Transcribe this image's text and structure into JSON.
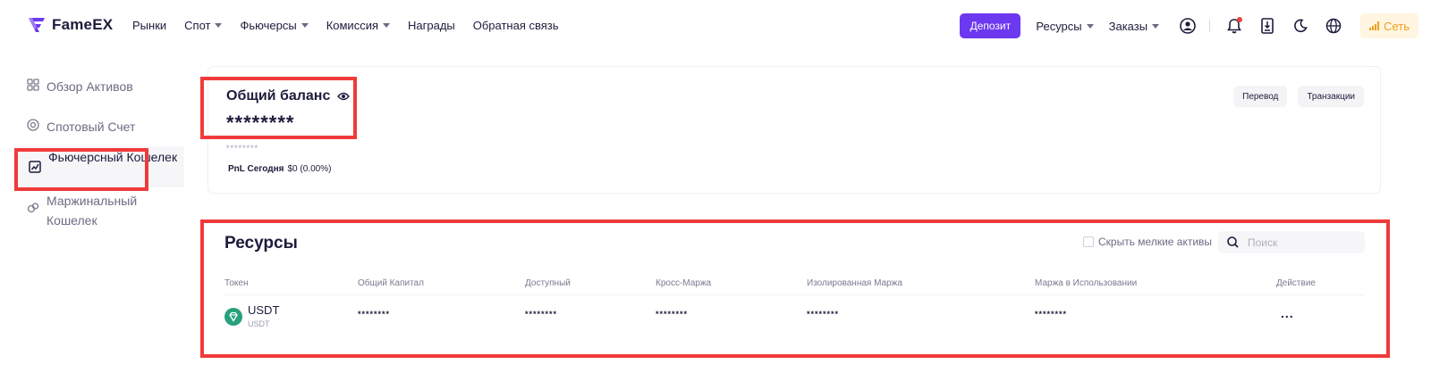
{
  "header": {
    "logo_text": "FameEX",
    "nav": [
      {
        "label": "Рынки",
        "dropdown": false
      },
      {
        "label": "Спот",
        "dropdown": true
      },
      {
        "label": "Фьючерсы",
        "dropdown": true
      },
      {
        "label": "Комиссия",
        "dropdown": true
      },
      {
        "label": "Награды",
        "dropdown": false
      },
      {
        "label": "Обратная связь",
        "dropdown": false
      }
    ],
    "deposit_label": "Депозит",
    "resources_label": "Ресурсы",
    "orders_label": "Заказы",
    "network_label": "Сеть",
    "icons": [
      "user-icon",
      "bell-icon",
      "download-icon",
      "moon-icon",
      "globe-icon"
    ],
    "accent_color": "#6c38f0",
    "network_color": "#f0a020"
  },
  "sidebar": {
    "items": [
      {
        "label": "Обзор Активов",
        "icon": "grid-icon",
        "active": false
      },
      {
        "label": "Спотовый Счет",
        "icon": "target-icon",
        "active": false
      },
      {
        "label": "Фьючерсный Кошелек",
        "icon": "chart-wallet-icon",
        "active": true
      },
      {
        "label": "Маржинальный Кошелек",
        "icon": "coins-icon",
        "active": false
      }
    ]
  },
  "balance": {
    "title": "Общий баланс",
    "value": "********",
    "sub_value": "********",
    "pnl_label": "PnL Сегодня",
    "pnl_value": "$0 (0.00%)",
    "transfer_label": "Перевод",
    "transactions_label": "Транзакции"
  },
  "resources": {
    "title": "Ресурсы",
    "hide_small_label": "Скрыть мелкие активы",
    "search_placeholder": "Поиск",
    "columns": [
      "Токен",
      "Общий Капитал",
      "Доступный",
      "Кросс-Маржа",
      "Изолированная Маржа",
      "Маржа в Использовании",
      "Действие"
    ],
    "rows": [
      {
        "token": "USDT",
        "token_sub": "USDT",
        "total_capital": "********",
        "available": "********",
        "cross_margin": "********",
        "isolated_margin": "********",
        "margin_in_use": "********",
        "action": "..."
      }
    ]
  }
}
